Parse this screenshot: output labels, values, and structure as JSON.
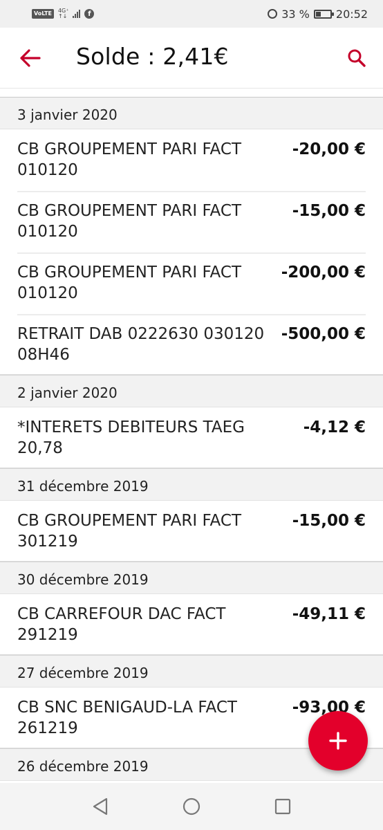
{
  "statusbar": {
    "volte": "VoLTE",
    "network_top": "4G⁺",
    "network_bottom": "↑↓",
    "fb": "f",
    "battery": "33 %",
    "battery_level": 0.33,
    "time": "20:52"
  },
  "header": {
    "title": "Solde : 2,41€",
    "accent": "#c4002a"
  },
  "groups": [
    {
      "date": "3 janvier 2020",
      "items": [
        {
          "label": "CB GROUPEMENT PARI FACT\n010120",
          "amount": "-20,00 €"
        },
        {
          "label": "CB GROUPEMENT PARI FACT\n010120",
          "amount": "-15,00 €"
        },
        {
          "label": "CB GROUPEMENT PARI FACT\n010120",
          "amount": "-200,00 €"
        },
        {
          "label": "RETRAIT DAB 0222630 030120\n08H46",
          "amount": "-500,00 €"
        }
      ]
    },
    {
      "date": "2 janvier 2020",
      "items": [
        {
          "label": "*INTERETS DEBITEURS TAEG\n20,78",
          "amount": "-4,12 €"
        }
      ]
    },
    {
      "date": "31 décembre 2019",
      "items": [
        {
          "label": "CB GROUPEMENT PARI FACT\n301219",
          "amount": "-15,00 €"
        }
      ]
    },
    {
      "date": "30 décembre 2019",
      "items": [
        {
          "label": "CB CARREFOUR DAC FACT\n291219",
          "amount": "-49,11 €"
        }
      ]
    },
    {
      "date": "27 décembre 2019",
      "items": [
        {
          "label": "CB SNC BENIGAUD-LA FACT\n261219",
          "amount": "-93,00 €"
        }
      ]
    },
    {
      "date": "26 décembre 2019",
      "items": []
    }
  ],
  "fab": {
    "icon": "plus-icon",
    "color": "#e3002b"
  },
  "navbar": {
    "back": "back-triangle-icon",
    "home": "home-circle-icon",
    "recents": "recents-square-icon"
  }
}
